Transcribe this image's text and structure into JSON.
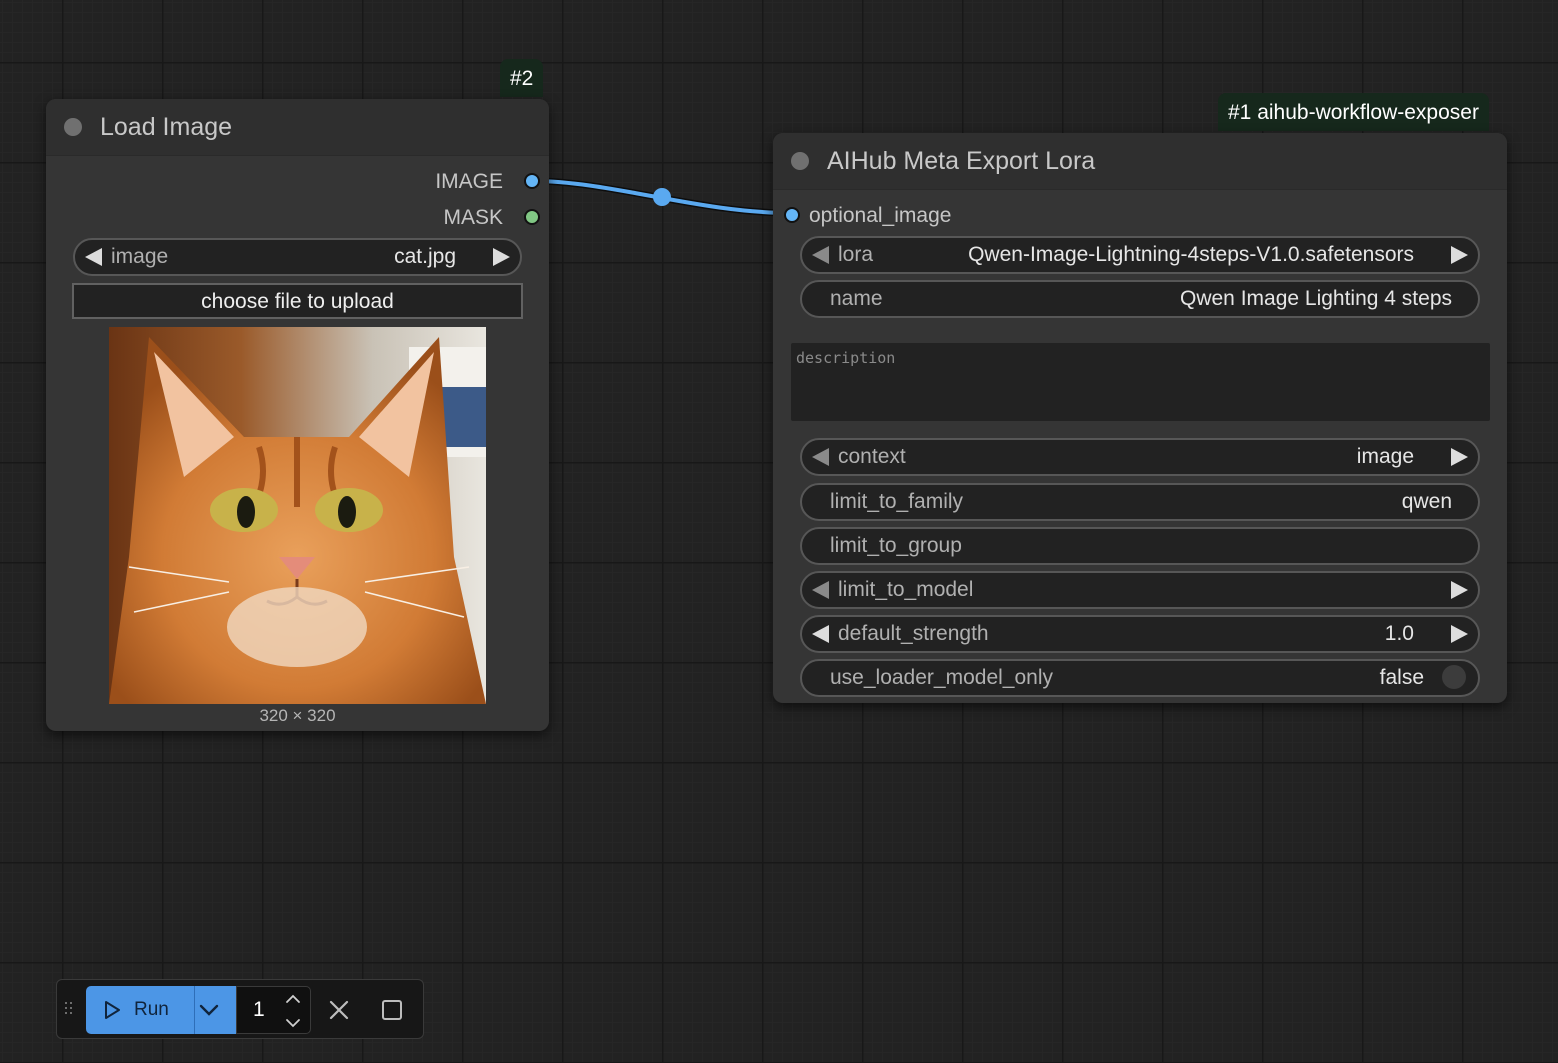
{
  "badges": {
    "load_image_id": "#2",
    "lora_id": "#1 aihub-workflow-exposer"
  },
  "load_image_node": {
    "title": "Load Image",
    "outputs": [
      "IMAGE",
      "MASK"
    ],
    "image_widget": {
      "label": "image",
      "value": "cat.jpg"
    },
    "upload_label": "choose file to upload",
    "preview_size": "320 × 320",
    "preview_subject": "orange tabby cat"
  },
  "lora_node": {
    "title": "AIHub Meta Export Lora",
    "input": "optional_image",
    "lora": {
      "label": "lora",
      "value": "Qwen-Image-Lightning-4steps-V1.0.safetensors"
    },
    "name": {
      "label": "name",
      "value": "Qwen Image Lighting 4 steps"
    },
    "description_placeholder": "description",
    "context": {
      "label": "context",
      "value": "image"
    },
    "limit_to_family": {
      "label": "limit_to_family",
      "value": "qwen"
    },
    "limit_to_group": {
      "label": "limit_to_group",
      "value": ""
    },
    "limit_to_model": {
      "label": "limit_to_model",
      "value": ""
    },
    "default_strength": {
      "label": "default_strength",
      "value": "1.0"
    },
    "use_loader_model_only": {
      "label": "use_loader_model_only",
      "value": "false"
    }
  },
  "toolbar": {
    "run_label": "Run",
    "batch_count": "1"
  },
  "colors": {
    "link": "#5aa9f0",
    "image_slot": "#64b5f6",
    "mask_slot": "#81c784",
    "run_button": "#4c96e6",
    "badge_bg": "#16281c"
  },
  "icons": [
    "play-icon",
    "chevron-down-icon",
    "chevron-up-icon",
    "close-icon",
    "stop-icon",
    "drag-handle-icon"
  ]
}
